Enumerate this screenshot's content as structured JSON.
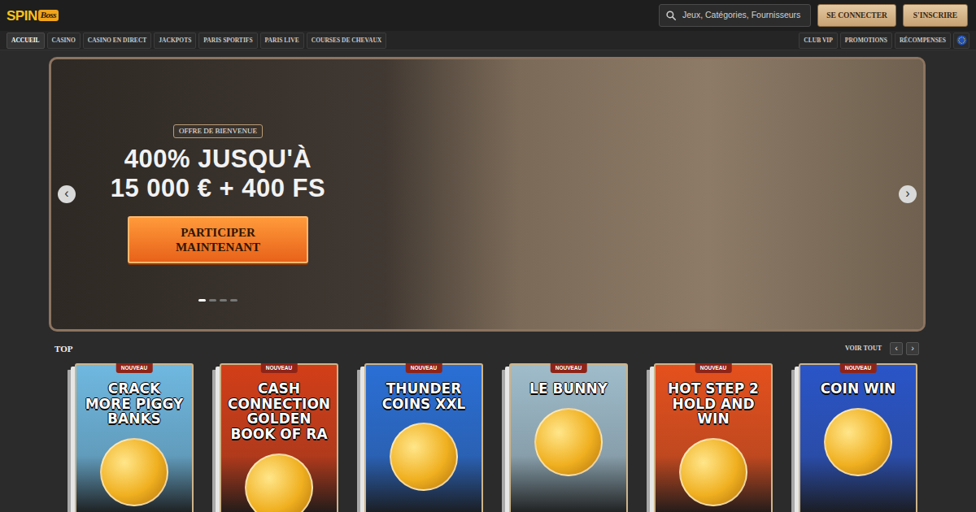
{
  "logo": {
    "text1": "SPIN",
    "text2": "Boss"
  },
  "search": {
    "placeholder": "Jeux, Catégories, Fournisseurs"
  },
  "auth_buttons": [
    "SE CONNECTER",
    "S'INSCRIRE"
  ],
  "nav": {
    "left": [
      {
        "label": "ACCUEIL",
        "selected": true
      },
      {
        "label": "CASINO",
        "selected": false
      },
      {
        "label": "CASINO EN DIRECT",
        "selected": false
      },
      {
        "label": "JACKPOTS",
        "selected": false
      },
      {
        "label": "PARIS SPORTIFS",
        "selected": false
      },
      {
        "label": "PARIS LIVE",
        "selected": false
      },
      {
        "label": "COURSES DE CHEVAUX",
        "selected": false
      }
    ],
    "right": [
      {
        "label": "CLUB VIP",
        "selected": false
      },
      {
        "label": "PROMOTIONS",
        "selected": false
      },
      {
        "label": "RÉCOMPENSES",
        "selected": false
      }
    ]
  },
  "hero": {
    "badge": "OFFRE DE BIENVENUE",
    "title_lines": [
      "400% JUSQU'À",
      "15 000 € + 400 FS"
    ],
    "cta": "PARTICIPER MAINTENANT",
    "prev": "‹",
    "next": "›",
    "slides": [
      {
        "selected": true
      },
      {
        "selected": false
      },
      {
        "selected": false
      },
      {
        "selected": false
      }
    ]
  },
  "section": {
    "title": "TOP",
    "see_all": "VOIR TOUT",
    "prev": "‹",
    "next": "›"
  },
  "games": [
    {
      "title": "CRACK MORE PIGGY BANKS",
      "badge": "NOUVEAU",
      "color": "#6fb8e0"
    },
    {
      "title": "CASH CONNECTION GOLDEN BOOK OF RA",
      "badge": "NOUVEAU",
      "color": "#d23e18"
    },
    {
      "title": "THUNDER COINS XXL",
      "badge": "NOUVEAU",
      "color": "#2a6fd6"
    },
    {
      "title": "LE BUNNY",
      "badge": "NOUVEAU",
      "color": "#9fbccb"
    },
    {
      "title": "HOT STEP 2 HOLD AND WIN",
      "badge": "NOUVEAU",
      "color": "#e5501d"
    },
    {
      "title": "COIN WIN",
      "badge": "NOUVEAU",
      "color": "#2a55c8"
    }
  ]
}
